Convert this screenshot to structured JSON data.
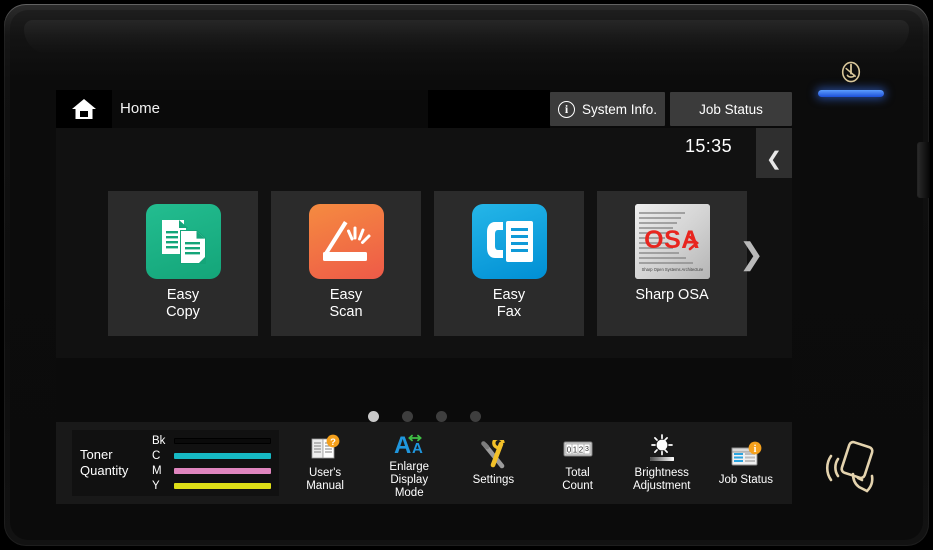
{
  "device": {
    "power_icon": "power-button-icon",
    "led": "status-led-blue",
    "nfc_icon": "nfc-card-reader-icon"
  },
  "header": {
    "home_icon": "home-icon",
    "title": "Home",
    "system_info_label": "System Info.",
    "system_info_icon": "info-circle-icon",
    "job_status_label": "Job Status",
    "clock": "15:35",
    "collapse_icon": "chevron-left-icon"
  },
  "tiles": [
    {
      "label": "Easy\nCopy",
      "icon": "copy-documents-icon",
      "style": "t-copy"
    },
    {
      "label": "Easy\nScan",
      "icon": "scanner-icon",
      "style": "t-scan"
    },
    {
      "label": "Easy\nFax",
      "icon": "fax-phone-icon",
      "style": "t-fax"
    },
    {
      "label": "Sharp OSA",
      "icon": "sharp-osa-logo",
      "style": "t-osa"
    }
  ],
  "osa_logo": {
    "text": "OSA",
    "subtitle": "Sharp Open Systems Architecture",
    "text_color": "#e8251f"
  },
  "pager": {
    "next_icon": "chevron-right-icon",
    "dots": [
      true,
      false,
      false,
      false
    ],
    "page_count": 4,
    "current_page": 1
  },
  "toner": {
    "title": "Toner\nQuantity",
    "rows": [
      {
        "key": "Bk",
        "color": "#0a0a0a",
        "level": 100
      },
      {
        "key": "C",
        "color": "#16b9c4",
        "level": 100
      },
      {
        "key": "M",
        "color": "#e085bf",
        "level": 100
      },
      {
        "key": "Y",
        "color": "#dede17",
        "level": 100
      }
    ]
  },
  "shortcuts": [
    {
      "label": "User's\nManual",
      "icon": "manual-book-help-icon"
    },
    {
      "label": "Enlarge\nDisplay\nMode",
      "icon": "enlarge-text-icon"
    },
    {
      "label": "Settings",
      "icon": "tools-wrench-screwdriver-icon"
    },
    {
      "label": "Total\nCount",
      "icon": "counter-icon",
      "counter": "0123"
    },
    {
      "label": "Brightness\nAdjustment",
      "icon": "brightness-sun-icon"
    },
    {
      "label": "Job Status",
      "icon": "job-status-window-icon"
    }
  ]
}
